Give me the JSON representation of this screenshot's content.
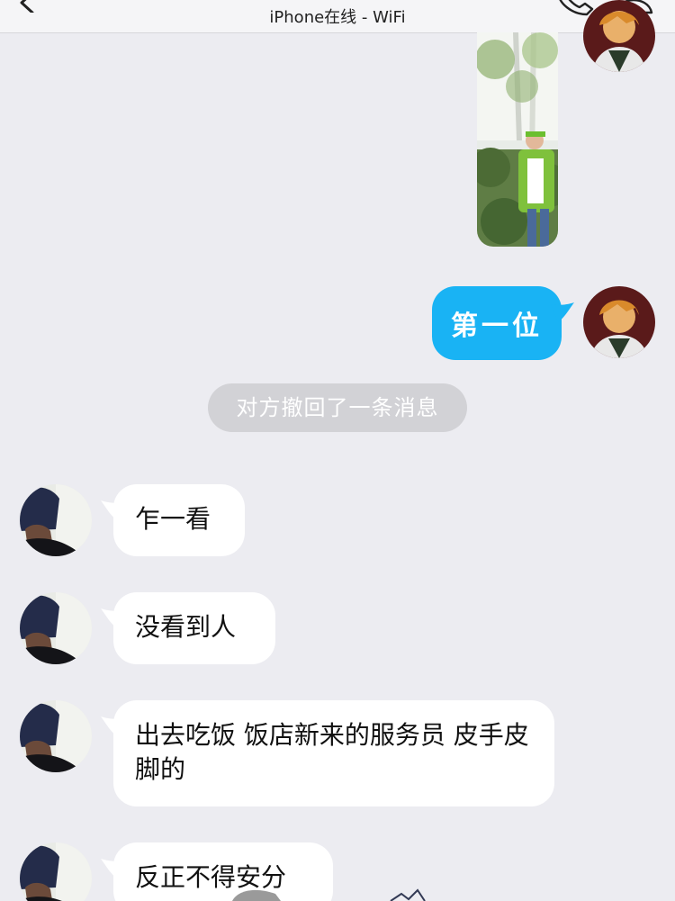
{
  "header": {
    "title": "iPhone在线 - WiFi"
  },
  "messages": {
    "sent_text": "第一位",
    "recall_notice": "对方撤回了一条消息",
    "received": [
      {
        "text": "乍一看"
      },
      {
        "text": "没看到人"
      },
      {
        "text": "出去吃饭 饭店新来的服务员 皮手皮脚的"
      },
      {
        "text": "反正不得安分"
      }
    ]
  },
  "colors": {
    "background": "#ececf1",
    "sent_bubble": "#19b3f4",
    "received_bubble": "#ffffff",
    "recall_pill": "#d2d2d6"
  },
  "icons": {
    "back": "chevron-left-icon",
    "call": "phone-icon",
    "profile": "person-icon"
  }
}
